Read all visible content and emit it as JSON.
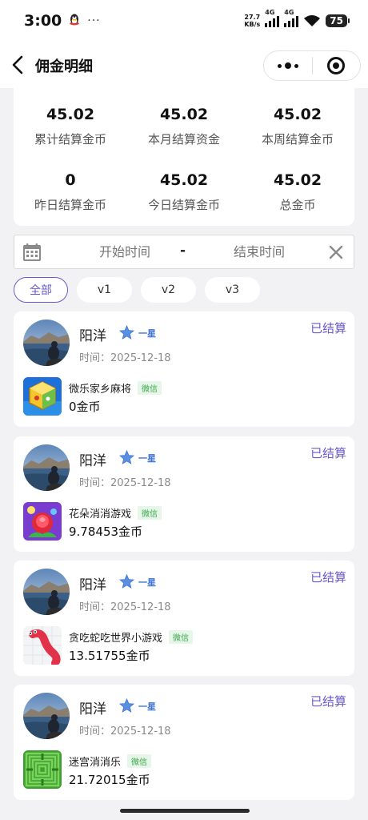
{
  "status_bar": {
    "time": "3:00",
    "dots": "···",
    "net_speed_value": "27.7",
    "net_speed_unit": "KB/s",
    "network_1": "4G",
    "network_2": "4G",
    "battery": "75"
  },
  "nav": {
    "title": "佣金明细"
  },
  "summary": [
    {
      "value": "45.02",
      "label": "累计结算金币"
    },
    {
      "value": "45.02",
      "label": "本月结算资金"
    },
    {
      "value": "45.02",
      "label": "本周结算金币"
    },
    {
      "value": "0",
      "label": "昨日结算金币"
    },
    {
      "value": "45.02",
      "label": "今日结算金币"
    },
    {
      "value": "45.02",
      "label": "总金币"
    }
  ],
  "date_filter": {
    "start_placeholder": "开始时间",
    "separator": "-",
    "end_placeholder": "结束时间"
  },
  "tabs": [
    {
      "label": "全部",
      "active": true
    },
    {
      "label": "v1",
      "active": false
    },
    {
      "label": "v2",
      "active": false
    },
    {
      "label": "v3",
      "active": false
    }
  ],
  "records": [
    {
      "name": "阳洋",
      "level": "一星",
      "time_label": "时间：",
      "time": "2025-12-18",
      "status": "已结算",
      "game": "微乐家乡麻将",
      "platform": "微信",
      "coins": "0金币"
    },
    {
      "name": "阳洋",
      "level": "一星",
      "time_label": "时间：",
      "time": "2025-12-18",
      "status": "已结算",
      "game": "花朵消消游戏",
      "platform": "微信",
      "coins": "9.78453金币"
    },
    {
      "name": "阳洋",
      "level": "一星",
      "time_label": "时间：",
      "time": "2025-12-18",
      "status": "已结算",
      "game": "贪吃蛇吃世界小游戏",
      "platform": "微信",
      "coins": "13.51755金币"
    },
    {
      "name": "阳洋",
      "level": "一星",
      "time_label": "时间：",
      "time": "2025-12-18",
      "status": "已结算",
      "game": "迷宫消消乐",
      "platform": "微信",
      "coins": "21.72015金币"
    }
  ],
  "colors": {
    "accent": "#6a5acd",
    "wechat_green": "#3aa84a",
    "star_blue": "#3a72d8",
    "background": "#f2f2f4"
  }
}
